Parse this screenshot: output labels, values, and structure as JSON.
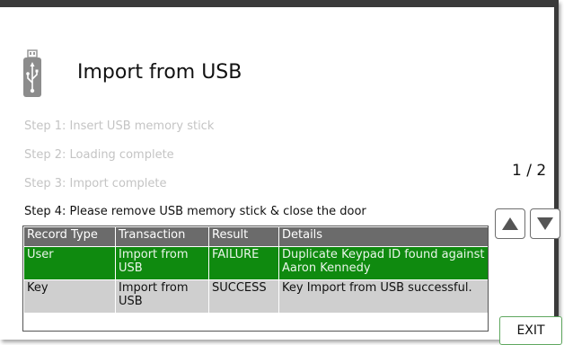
{
  "header": {
    "icon": "usb-drive-icon",
    "title": "Import from USB"
  },
  "steps": [
    {
      "label": "Step 1: Insert USB memory stick",
      "state": "done"
    },
    {
      "label": "Step 2: Loading complete",
      "state": "done"
    },
    {
      "label": "Step 3: Import complete",
      "state": "done"
    },
    {
      "label": "Step 4: Please remove USB memory stick & close the door",
      "state": "active"
    }
  ],
  "pager": {
    "text": "1 / 2",
    "up_icon": "triangle-up-icon",
    "down_icon": "triangle-down-icon"
  },
  "table": {
    "columns": [
      "Record Type",
      "Transaction",
      "Result",
      "Details"
    ],
    "rows": [
      {
        "record_type": "User",
        "transaction": "Import from USB",
        "result": "FAILURE",
        "details": "Duplicate Keypad ID found against Aaron Kennedy",
        "color": "#0f8a0f"
      },
      {
        "record_type": "Key",
        "transaction": "Import from USB",
        "result": "SUCCESS",
        "details": "Key Import from USB successful.",
        "color": "#cfcfcf"
      }
    ]
  },
  "exit_label": "EXIT",
  "colors": {
    "failure_row": "#0f8a0f",
    "success_row": "#cfcfcf",
    "header_row": "#6b6b6b",
    "exit_border": "#5fa75f"
  }
}
